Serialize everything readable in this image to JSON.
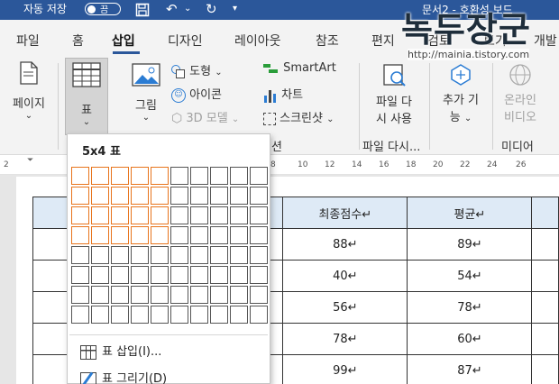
{
  "titlebar": {
    "autosave_label": "자동 저장",
    "autosave_state": "끔",
    "doc_title": "문서2 - 호환성 보드"
  },
  "tabs": [
    "파일",
    "홈",
    "삽입",
    "디자인",
    "레이아웃",
    "참조",
    "편지",
    "검토",
    "보기",
    "개발"
  ],
  "active_tab": "삽입",
  "ribbon": {
    "page_label": "페이지",
    "table_label": "표",
    "picture_label": "그림",
    "shapes_label": "도형",
    "icons_label": "아이콘",
    "models3d_label": "3D 모델",
    "smartart_label": "SmartArt",
    "chart_label": "차트",
    "screenshot_label": "스크린샷",
    "file_button_line1": "파일 다",
    "file_button_line2": "시 사용",
    "addins_line1": "추가 기",
    "addins_line2": "능",
    "online_video_line1": "온라인",
    "online_video_line2": "비디오",
    "group_partial": "션",
    "group_file": "파일 다시...",
    "group_media": "미디어"
  },
  "ruler": {
    "left_mark": "2",
    "marks": [
      "8",
      "10",
      "12",
      "14",
      "16",
      "18",
      "20",
      "22",
      "24",
      "26"
    ]
  },
  "table_dropdown": {
    "title": "5x4 표",
    "selected_cols": 5,
    "selected_rows": 4,
    "insert_table": "표 삽입(I)...",
    "draw_table": "표 그리기(D)"
  },
  "document_table": {
    "headers": [
      "최종점수↵",
      "평균↵"
    ],
    "rows": [
      [
        "88↵",
        "89↵"
      ],
      [
        "40↵",
        "54↵"
      ],
      [
        "56↵",
        "78↵"
      ],
      [
        "78↵",
        "60↵"
      ],
      [
        "99↵",
        "87↵"
      ]
    ]
  },
  "watermark": {
    "logo_text": "녹두장군",
    "url": "http://mainia.tistory.com"
  },
  "colors": {
    "title_bar": "#2b579a",
    "ribbon_bg": "#f3f3f3",
    "grid_selected": "#e8741c",
    "table_header_bg": "#deeaf6"
  }
}
